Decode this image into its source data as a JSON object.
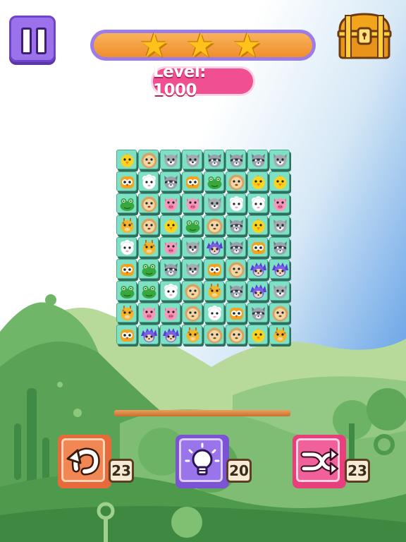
{
  "level": {
    "label": "Level: 1000"
  },
  "progress": {
    "stars_earned": 3,
    "stars_total": 3,
    "fill_fraction": 1.0
  },
  "tools": {
    "undo": {
      "count": "23",
      "icon": "undo-arrow-icon"
    },
    "hint": {
      "count": "20",
      "icon": "lightbulb-icon"
    },
    "shuffle": {
      "count": "23",
      "icon": "shuffle-icon"
    }
  },
  "board": {
    "columns": 8,
    "rows": 9,
    "tiles": [
      [
        "chick",
        "lion",
        "wolf",
        "wolf",
        "raccoon",
        "raccoon",
        "raccoon",
        "wolf"
      ],
      [
        "owl",
        "sheep",
        "raccoon",
        "owl",
        "frog",
        "lion",
        "chick",
        "chick"
      ],
      [
        "frog",
        "lion",
        "pig",
        "pig",
        "wolf",
        "sheep",
        "sheep",
        "pig"
      ],
      [
        "giraffe",
        "lion",
        "chick",
        "frog",
        "lion",
        "raccoon",
        "chick",
        "wolf"
      ],
      [
        "sheep",
        "giraffe",
        "pig",
        "wolf",
        "hedgehog",
        "raccoon",
        "owl",
        "raccoon"
      ],
      [
        "owl",
        "frog",
        "raccoon",
        "wolf",
        "owl",
        "lion",
        "hedgehog",
        "hedgehog"
      ],
      [
        "frog",
        "frog",
        "sheep",
        "lion",
        "giraffe",
        "raccoon",
        "hedgehog",
        "wolf"
      ],
      [
        "giraffe",
        "pig",
        "pig",
        "lion",
        "sheep",
        "owl",
        "raccoon",
        "lion"
      ],
      [
        "owl",
        "hedgehog",
        "hedgehog",
        "giraffe",
        "lion",
        "lion",
        "chick",
        "giraffe"
      ]
    ]
  },
  "colors": {
    "tile_face": "#7ee0c5",
    "tile_side": "#2f6e5c",
    "level_pill": "#f04f91",
    "progress_fill": "#f59d3e",
    "star": "#ffc21a"
  },
  "icons": {
    "pause": "pause-icon",
    "chest": "treasure-chest-icon",
    "star": "star-icon"
  }
}
